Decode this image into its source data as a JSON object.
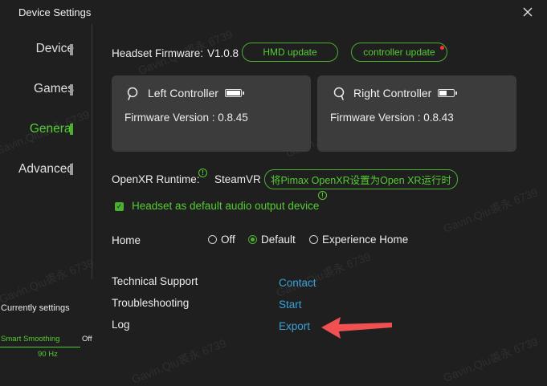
{
  "window": {
    "title": "Device Settings"
  },
  "sidebar": {
    "items": [
      {
        "label": "Device",
        "active": false
      },
      {
        "label": "Games",
        "active": false
      },
      {
        "label": "General",
        "active": true
      },
      {
        "label": "Advanced",
        "active": false
      }
    ],
    "current_settings_label": "Currently settings",
    "smoothing_label": "Smart Smoothing",
    "smoothing_value": "Off",
    "refresh_rate": "90 Hz"
  },
  "firmware": {
    "label": "Headset Firmware:",
    "version": "V1.0.8",
    "hmd_update_label": "HMD update",
    "controller_update_label": "controller update"
  },
  "controllers": {
    "left": {
      "name": "Left Controller",
      "firmware": "Firmware Version : 0.8.45",
      "battery_level": 1.0
    },
    "right": {
      "name": "Right Controller",
      "firmware": "Firmware Version : 0.8.43",
      "battery_level": 0.5
    }
  },
  "openxr": {
    "label": "OpenXR Runtime:",
    "value": "SteamVR",
    "set_button_label": "将Pimax OpenXR设置为Open XR运行时"
  },
  "audio": {
    "label": "Headset as default audio output device",
    "checked": true
  },
  "home": {
    "label": "Home",
    "options": [
      {
        "label": "Off",
        "checked": false
      },
      {
        "label": "Default",
        "checked": true
      },
      {
        "label": "Experience Home",
        "checked": false
      }
    ]
  },
  "support": {
    "technical_label": "Technical Support",
    "technical_link": "Contact",
    "troubleshooting_label": "Troubleshooting",
    "troubleshooting_link": "Start",
    "log_label": "Log",
    "log_link": "Export"
  },
  "watermark": "Gavin.Qiu裘永 6739",
  "colors": {
    "accent": "#4caf30",
    "link": "#3aa2d8",
    "background": "#1f1f1f",
    "card": "#3c3c3c",
    "annotation_arrow": "#f05050"
  }
}
